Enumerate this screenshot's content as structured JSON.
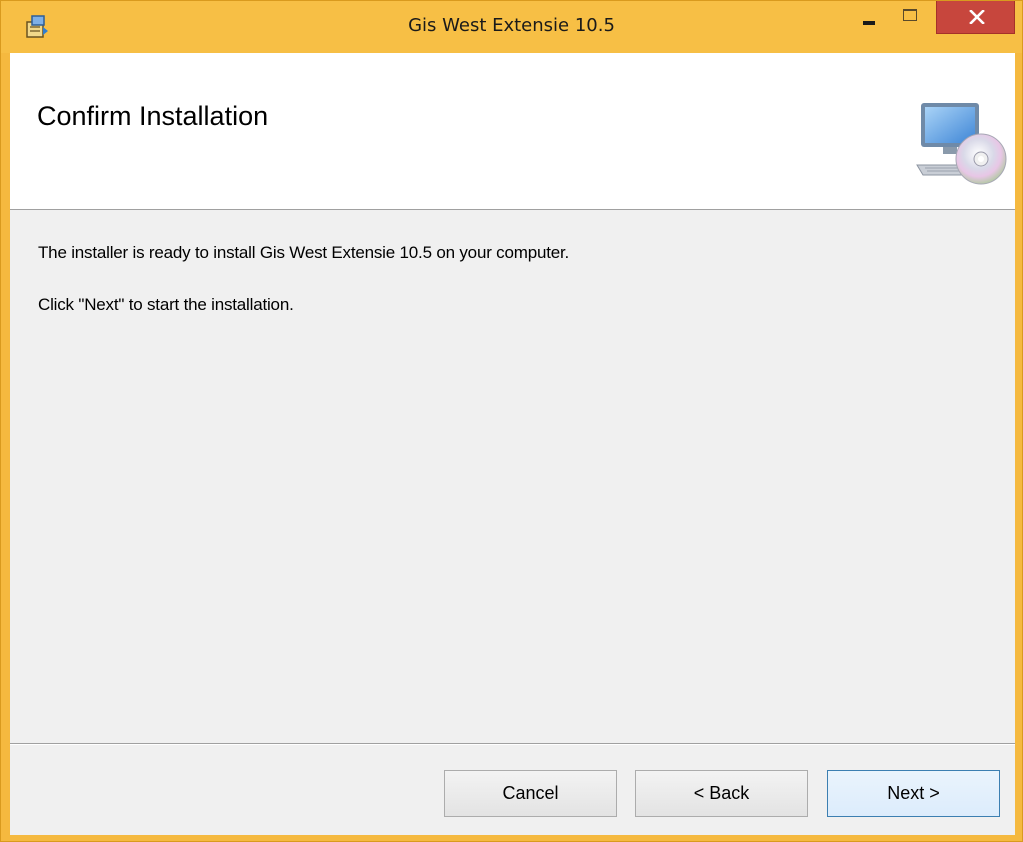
{
  "window": {
    "title": "Gis West Extensie 10.5",
    "app_icon": "installer-package-icon",
    "controls": {
      "minimize": "minimize-icon",
      "maximize": "maximize-icon",
      "close": "close-icon"
    },
    "colors": {
      "frame": "#f5b93f",
      "close_button": "#c7463d",
      "client_background": "#f0f0f0",
      "banner_background": "#ffffff"
    }
  },
  "banner": {
    "title": "Confirm Installation",
    "icon": "computer-disc-icon"
  },
  "body": {
    "line1": "The installer is ready to install Gis West Extensie 10.5 on your computer.",
    "line2": "Click \"Next\" to start the installation."
  },
  "buttons": {
    "cancel": "Cancel",
    "back": "< Back",
    "next": "Next >"
  }
}
